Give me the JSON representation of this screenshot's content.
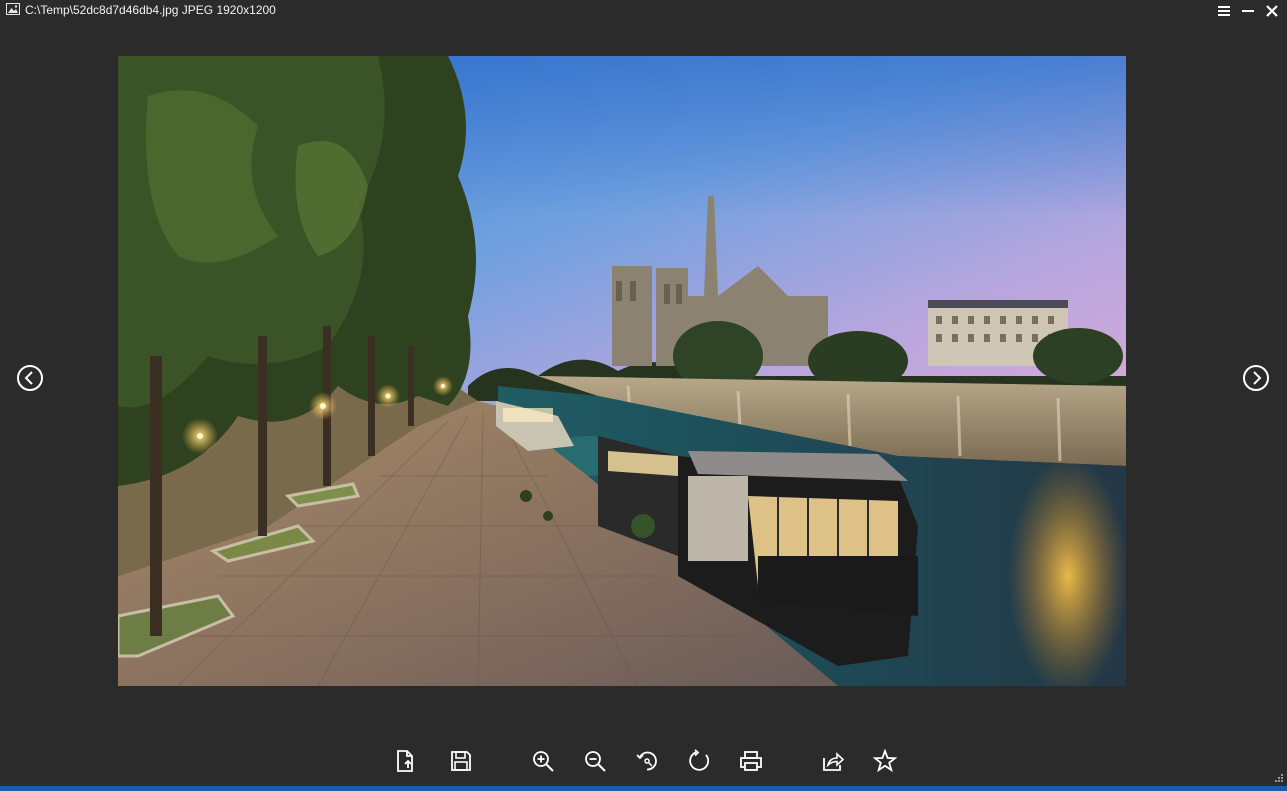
{
  "window": {
    "title": "C:\\Temp\\52dc8d7d46db4.jpg JPEG 1920x1200",
    "controls": [
      "menu-icon",
      "minimize-icon",
      "close-icon"
    ],
    "background": "#2b2b2b"
  },
  "navigation": {
    "previous_icon": "chevron-left-circle-icon",
    "next_icon": "chevron-right-circle-icon"
  },
  "toolbar": {
    "buttons": [
      {
        "name": "open-file-button",
        "icon": "file-export-icon"
      },
      {
        "name": "save-button",
        "icon": "save-icon"
      },
      {
        "name": "zoom-in-button",
        "icon": "zoom-in-icon"
      },
      {
        "name": "zoom-out-button",
        "icon": "zoom-out-icon"
      },
      {
        "name": "rotate-left-button",
        "icon": "rotate-left-icon"
      },
      {
        "name": "rotate-right-button",
        "icon": "rotate-right-icon"
      },
      {
        "name": "print-button",
        "icon": "print-icon"
      },
      {
        "name": "share-button",
        "icon": "share-icon"
      },
      {
        "name": "favorite-button",
        "icon": "star-icon"
      }
    ]
  },
  "colors": {
    "accent_strip": "#1f5ba8"
  }
}
